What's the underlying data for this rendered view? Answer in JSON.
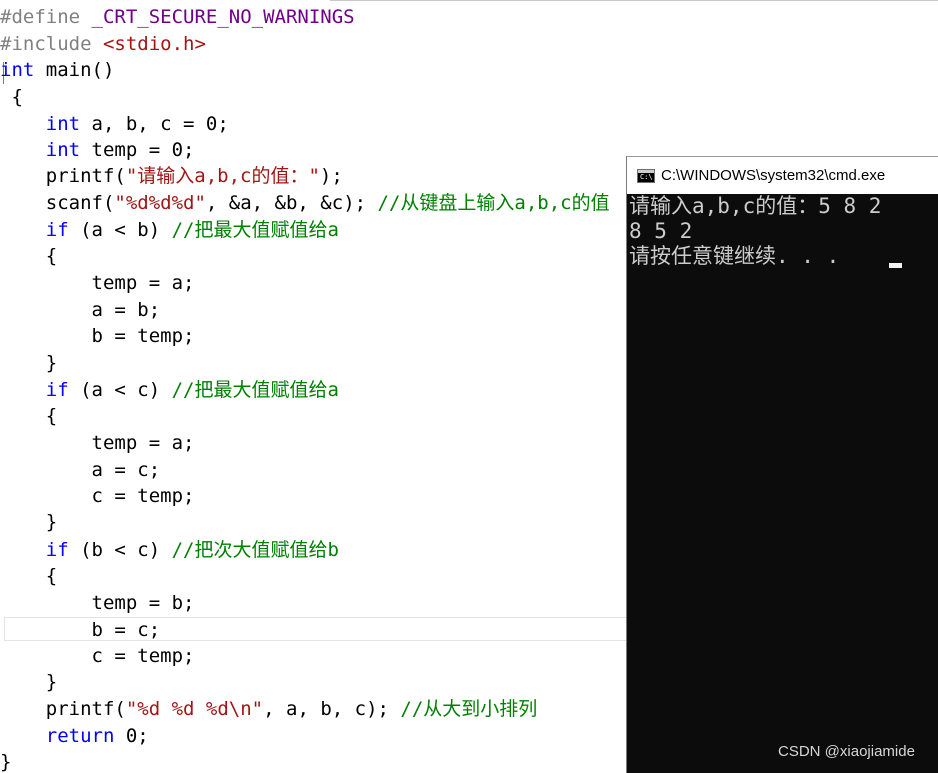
{
  "editor": {
    "line1": {
      "pp": "#define",
      "macro": " _CRT_SECURE_NO_WARNINGS"
    },
    "line2": {
      "pp": "#include",
      "header": " <stdio.h>"
    },
    "line3": {
      "kw": "int",
      "rest": " main()"
    },
    "line4": {
      "text": " {"
    },
    "line5": {
      "indent": "    ",
      "kw": "int",
      "rest": " a, b, c = 0;"
    },
    "line6": {
      "indent": "    ",
      "kw": "int",
      "rest": " temp = 0;"
    },
    "line7": {
      "indent": "    ",
      "fn": "printf(",
      "str": "\"请输入a,b,c的值：\"",
      "rest": ");"
    },
    "line8": {
      "indent": "    ",
      "fn": "scanf(",
      "str": "\"%d%d%d\"",
      "rest": ", &a, &b, &c); ",
      "comment": "//从键盘上输入a,b,c的值"
    },
    "line9": {
      "indent": "    ",
      "kw": "if",
      "rest": " (a < b) ",
      "comment": "//把最大值赋值给a"
    },
    "line10": {
      "text": "    {"
    },
    "line11": {
      "text": "        temp = a;"
    },
    "line12": {
      "text": "        a = b;"
    },
    "line13": {
      "text": "        b = temp;"
    },
    "line14": {
      "text": "    }"
    },
    "line15": {
      "indent": "    ",
      "kw": "if",
      "rest": " (a < c) ",
      "comment": "//把最大值赋值给a"
    },
    "line16": {
      "text": "    {"
    },
    "line17": {
      "text": "        temp = a;"
    },
    "line18": {
      "text": "        a = c;"
    },
    "line19": {
      "text": "        c = temp;"
    },
    "line20": {
      "text": "    }"
    },
    "line21": {
      "indent": "    ",
      "kw": "if",
      "rest": " (b < c) ",
      "comment": "//把次大值赋值给b"
    },
    "line22": {
      "text": "    {"
    },
    "line23": {
      "text": "        temp = b;"
    },
    "line24": {
      "text": "        b = c;"
    },
    "line25": {
      "text": "        c = temp;"
    },
    "line26": {
      "text": "    }"
    },
    "line27": {
      "indent": "    ",
      "fn": "printf(",
      "str": "\"%d %d %d\\n\"",
      "rest": ", a, b, c); ",
      "comment": "//从大到小排列"
    },
    "line28": {
      "indent": "    ",
      "kw": "return",
      "rest": " 0;"
    },
    "line29": {
      "text": "}"
    }
  },
  "console": {
    "icon_name": "cmd-icon",
    "icon_text": "C:\\",
    "title": "C:\\WINDOWS\\system32\\cmd.exe",
    "lines": [
      "请输入a,b,c的值：5 8 2",
      "8 5 2",
      "请按任意键继续. . . "
    ],
    "watermark": "CSDN @xiaojiamide"
  },
  "colors": {
    "preprocessor": "#808080",
    "macro": "#6f008a",
    "keyword": "#0000ff",
    "string": "#a31515",
    "comment": "#008000",
    "console_bg": "#0c0c0c",
    "console_text": "#cccccc"
  }
}
